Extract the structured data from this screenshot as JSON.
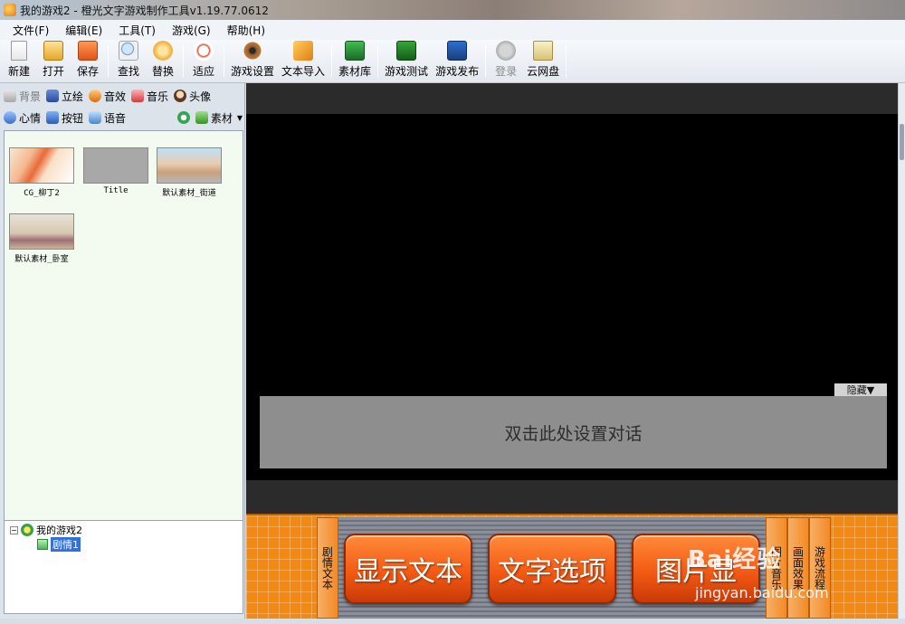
{
  "window": {
    "title": "我的游戏2 - 橙光文字游戏制作工具v1.19.77.0612"
  },
  "menu": [
    "文件(F)",
    "编辑(E)",
    "工具(T)",
    "游戏(G)",
    "帮助(H)"
  ],
  "toolbar": {
    "new": "新建",
    "open": "打开",
    "save": "保存",
    "find": "查找",
    "replace": "替换",
    "fit": "适应",
    "game_settings": "游戏设置",
    "text_import": "文本导入",
    "material_library": "素材库",
    "game_test": "游戏测试",
    "game_publish": "游戏发布",
    "login": "登录",
    "cloud_disk": "云网盘"
  },
  "resource_tabs": {
    "background": "背景",
    "standing": "立绘",
    "sound_effect": "音效",
    "music": "音乐",
    "avatar": "头像",
    "mood": "心情",
    "button": "按钮",
    "voice": "语音",
    "material": "素材"
  },
  "thumbnails": [
    "CG_柳丁2",
    "Title",
    "默认素材_街道",
    "默认素材_卧室"
  ],
  "tree": {
    "root": "我的游戏2",
    "child": "剧情1"
  },
  "stage": {
    "hide_label": "隐藏▼",
    "dialog_placeholder": "双击此处设置对话"
  },
  "commands": {
    "left_tab": "剧情文本",
    "show_text": "显示文本",
    "text_option": "文字选项",
    "image_partial": "图片显",
    "right_tabs": [
      "图片音乐",
      "画面效果",
      "游戏流程"
    ]
  },
  "watermark": {
    "brand": "Bai经验",
    "url": "jingyan.baidu.com"
  }
}
